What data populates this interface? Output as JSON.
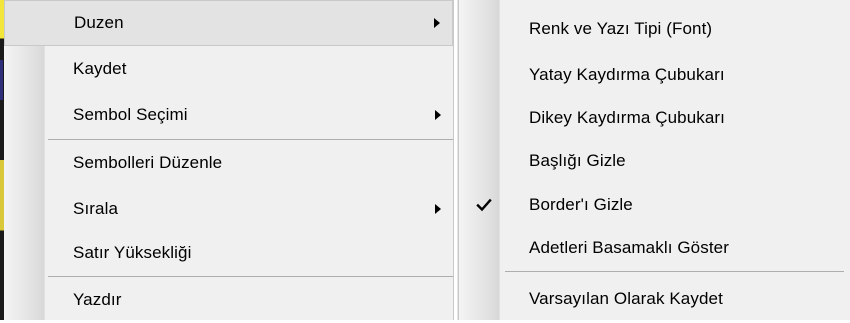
{
  "main_menu": {
    "items": [
      {
        "label": "Duzen",
        "has_submenu": true,
        "selected": true
      },
      {
        "label": "Kaydet"
      },
      {
        "label": "Sembol Seçimi",
        "has_submenu": true
      },
      {
        "label": "Sembolleri Düzenle"
      },
      {
        "label": "Sırala",
        "has_submenu": true
      },
      {
        "label": "Satır Yüksekliği"
      },
      {
        "label": "Yazdır"
      }
    ]
  },
  "sub_menu": {
    "items": [
      {
        "label": "Renk ve Yazı Tipi (Font)"
      },
      {
        "label": "Yatay Kaydırma Çubukarı"
      },
      {
        "label": "Dikey Kaydırma Çubukarı"
      },
      {
        "label": "Başlığı Gizle"
      },
      {
        "label": "Border'ı Gizle",
        "checked": true
      },
      {
        "label": "Adetleri Basamaklı Göster"
      },
      {
        "label": "Varsayılan Olarak Kaydet"
      }
    ]
  },
  "icons": {
    "submenu_arrow": "chevron-right-icon",
    "check": "check-icon"
  }
}
